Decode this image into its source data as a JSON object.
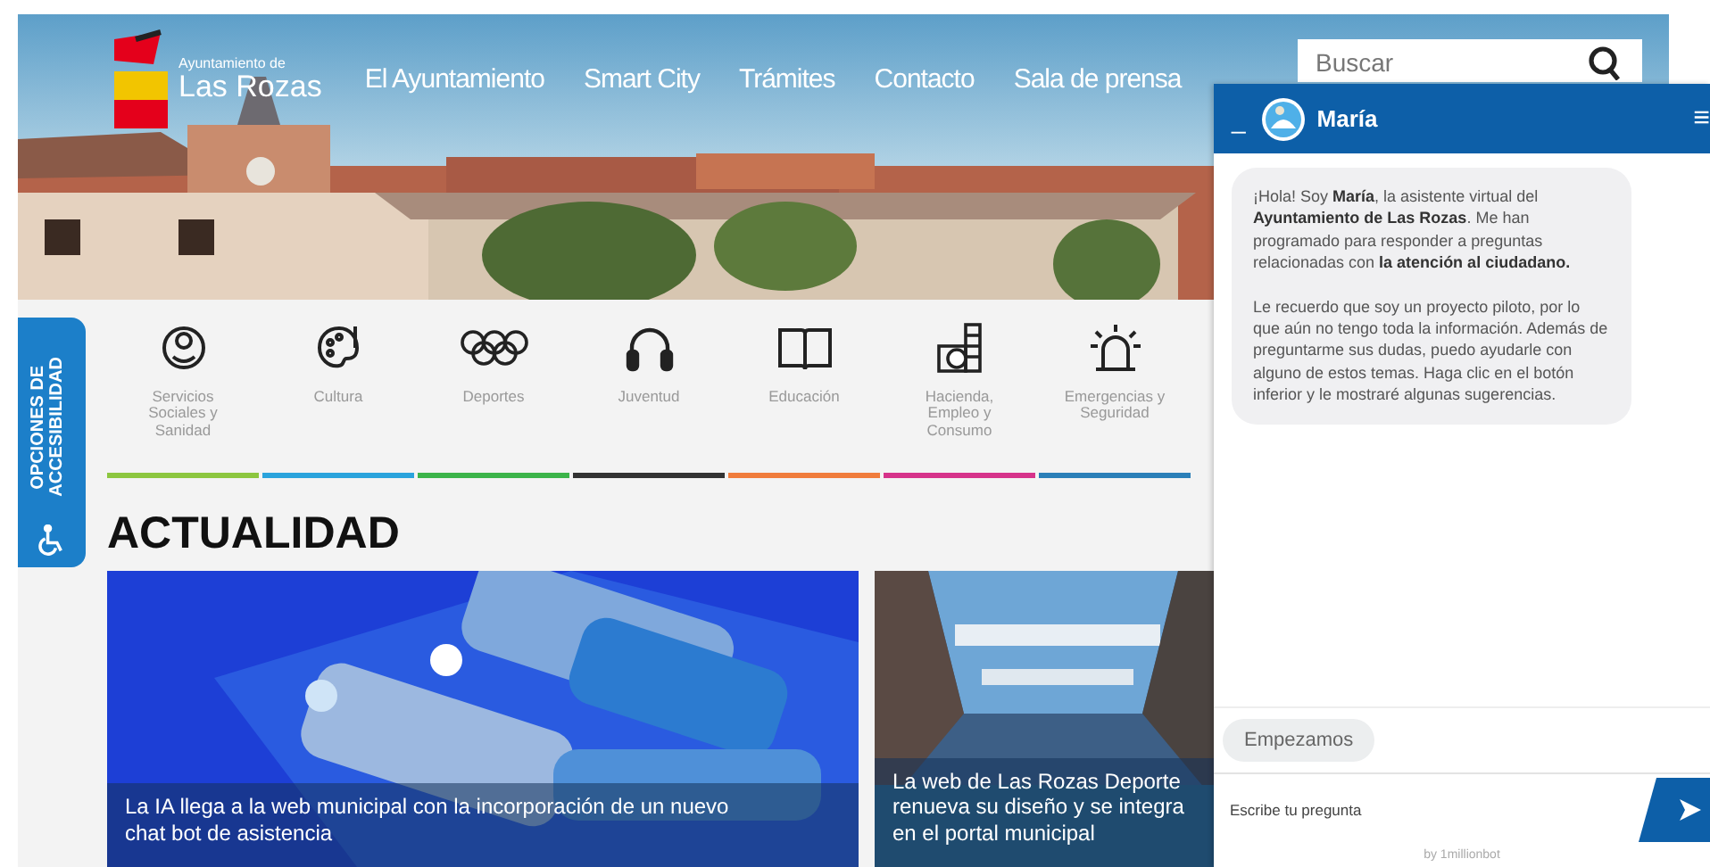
{
  "header": {
    "logo": {
      "line_1": "Ayuntamiento de",
      "line_2": "Las Rozas"
    },
    "nav": [
      "El Ayuntamiento",
      "Smart City",
      "Trámites",
      "Contacto",
      "Sala de prensa"
    ],
    "search": {
      "placeholder": "Buscar"
    }
  },
  "accessibility_tab": {
    "label": "OPCIONES DE ACCESIBILIDAD"
  },
  "categories": [
    {
      "label": "Servicios Sociales y Sanidad",
      "kind": "face",
      "color": "#8cc63f"
    },
    {
      "label": "Cultura",
      "kind": "palette",
      "color": "#2aa3dc"
    },
    {
      "label": "Deportes",
      "kind": "rings",
      "color": "#3cb44a"
    },
    {
      "label": "Juventud",
      "kind": "headphones",
      "color": "#333333"
    },
    {
      "label": "Educación",
      "kind": "book",
      "color": "#f07c3c"
    },
    {
      "label": "Hacienda, Empleo y Consumo",
      "kind": "coins",
      "color": "#d6338a"
    },
    {
      "label": "Emergencias y Seguridad",
      "kind": "siren",
      "color": "#2b7fb8"
    }
  ],
  "section_title": "ACTUALIDAD",
  "news": [
    {
      "kind": "phone",
      "title": [
        "La IA llega a la web municipal con la incorporación de un nuevo",
        "chat bot de asistencia"
      ]
    },
    {
      "kind": "hall",
      "title": [
        "La web de Las Rozas Deporte",
        "renueva su diseño y se integra",
        "en el portal municipal"
      ]
    }
  ],
  "chat": {
    "minimize": "_",
    "name": "María",
    "menu": "≡",
    "message": [
      "¡Hola! Soy **María**, la asistente virtual del **Ayuntamiento de Las Rozas**. Me han programado para responder a preguntas relacionadas con **la atención al ciudadano.**",
      "Le recuerdo que soy un proyecto piloto, por lo que aún no tengo toda la información. Además de preguntarme sus dudas, puedo ayudarle con alguno de estos temas. Haga clic en el botón inferior y le mostraré algunas sugerencias."
    ],
    "quick_reply": "Empezamos",
    "input": {
      "placeholder": "Escribe tu pregunta"
    },
    "footer": "by 1millionbot"
  }
}
